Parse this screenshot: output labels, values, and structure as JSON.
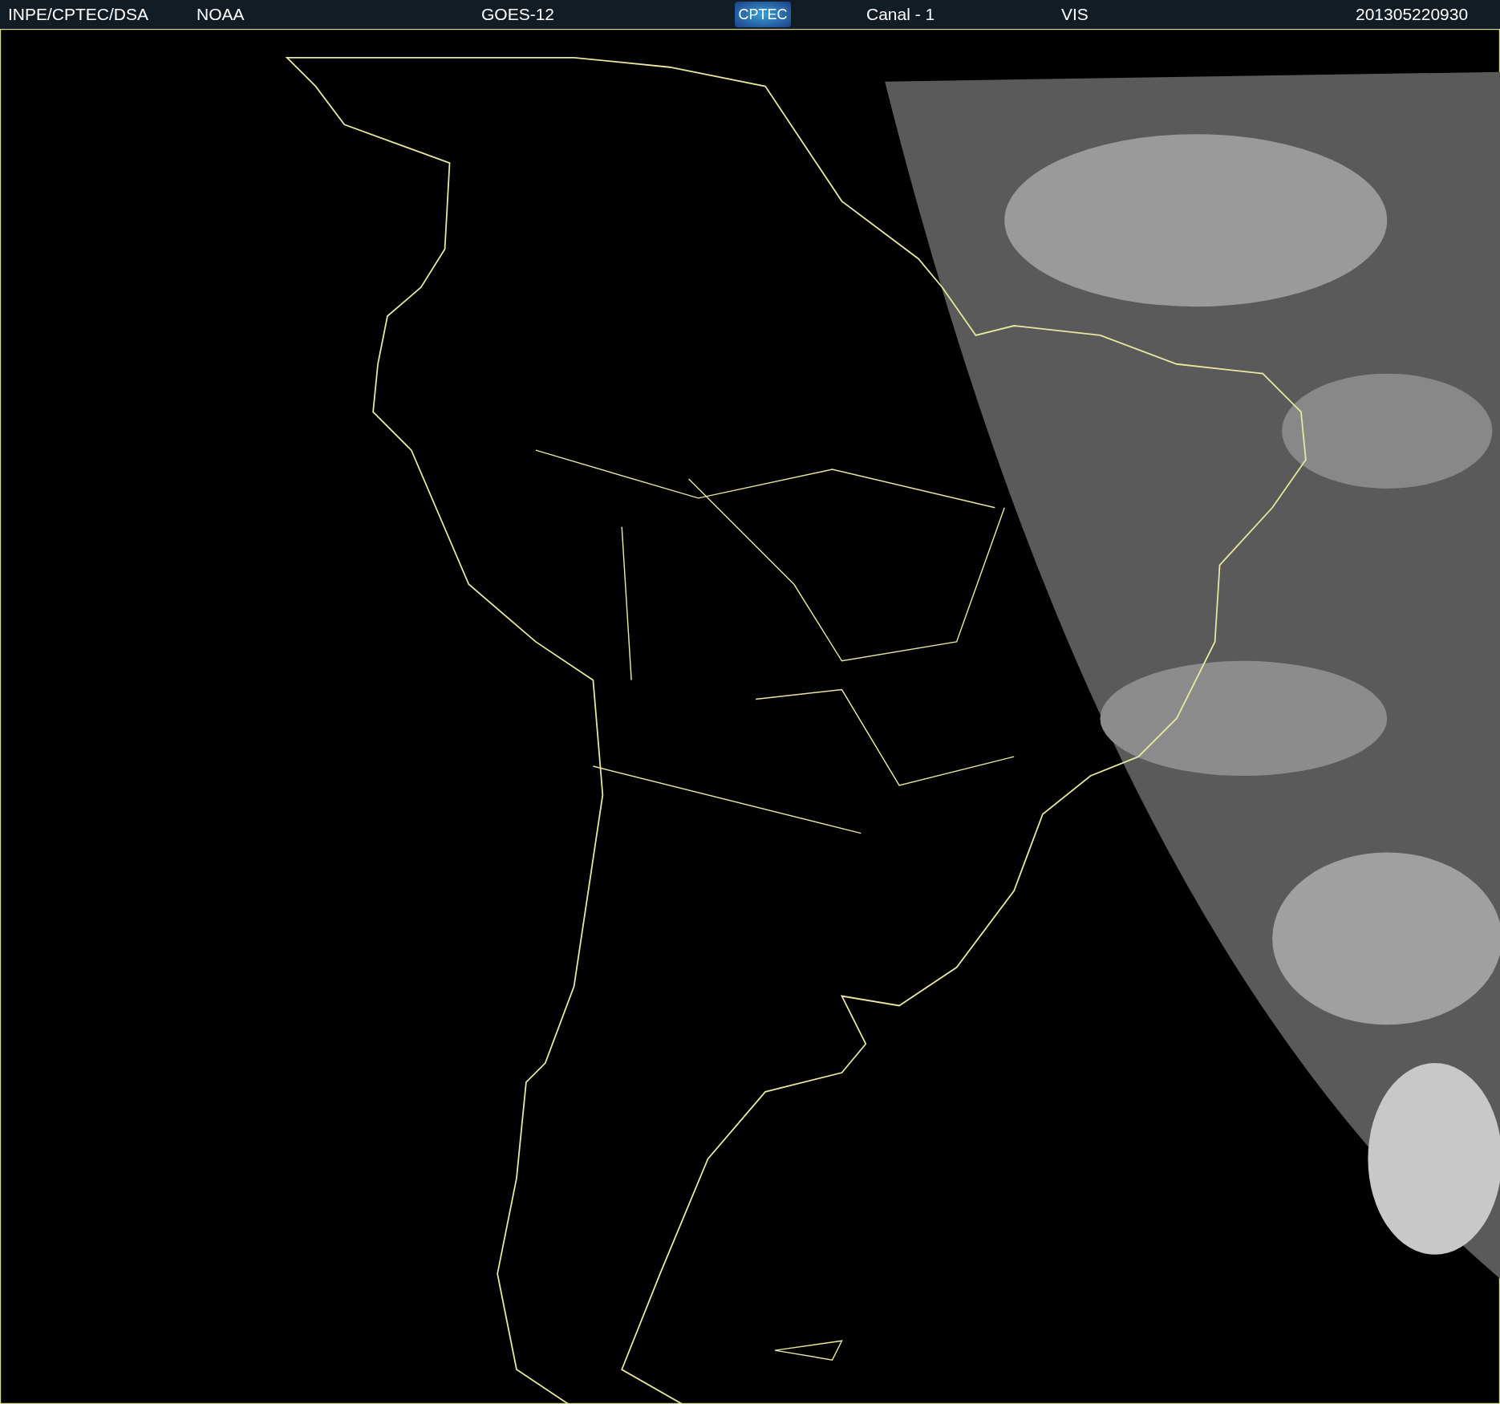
{
  "header": {
    "texts": [
      {
        "kind": "text",
        "label": "INPE/CPTEC/DSA"
      },
      {
        "kind": "text",
        "label": "NOAA"
      },
      {
        "kind": "text",
        "label": "GOES-12"
      },
      {
        "kind": "logo",
        "label": "CPTEC"
      },
      {
        "kind": "text",
        "label": "Canal - 1"
      },
      {
        "kind": "text",
        "label": "VIS"
      },
      {
        "kind": "text",
        "label": "201305220930"
      }
    ]
  }
}
